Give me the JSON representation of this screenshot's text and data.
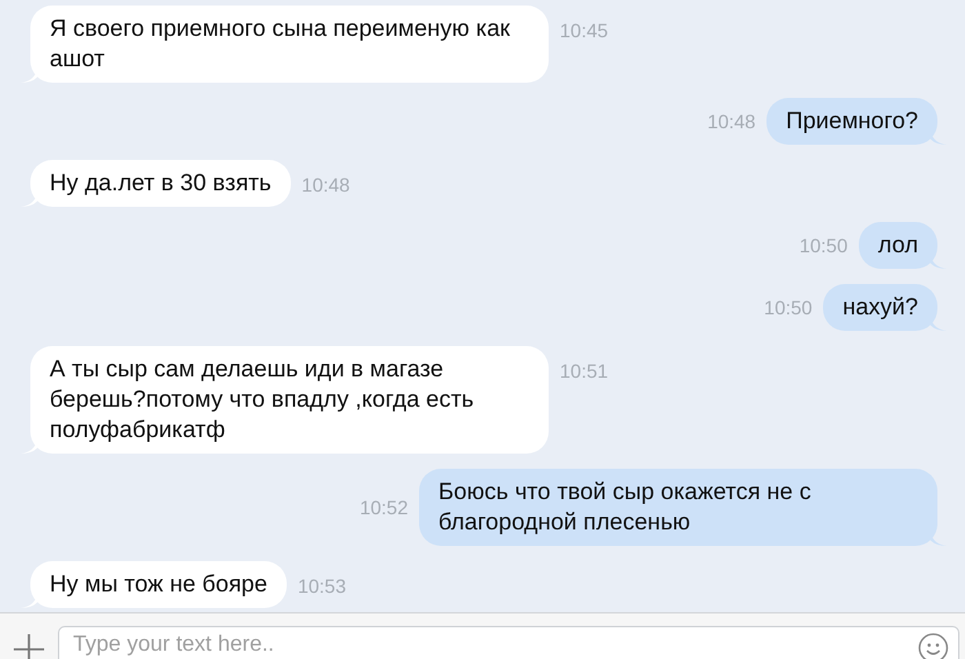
{
  "messages": [
    {
      "kind": "incoming",
      "text": "Я своего приемного сына переименую как ашот",
      "time": "10:45"
    },
    {
      "kind": "outgoing",
      "text": "Приемного?",
      "time": "10:48"
    },
    {
      "kind": "incoming",
      "text": "Ну да.лет в 30 взять",
      "time": "10:48"
    },
    {
      "kind": "outgoing",
      "text": "лол",
      "time": "10:50"
    },
    {
      "kind": "outgoing",
      "text": "нахуй?",
      "time": "10:50"
    },
    {
      "kind": "incoming",
      "text": "А ты сыр сам делаешь иди в магазе берешь?потому что впадлу ,когда есть полуфабрикатф",
      "time": "10:51"
    },
    {
      "kind": "outgoing",
      "text": "Боюсь что твой сыр окажется не с благородной плесенью",
      "time": "10:52"
    },
    {
      "kind": "incoming",
      "text": "Ну мы тож не бояре",
      "time": "10:53"
    }
  ],
  "composer": {
    "placeholder": "Type your text here.."
  }
}
